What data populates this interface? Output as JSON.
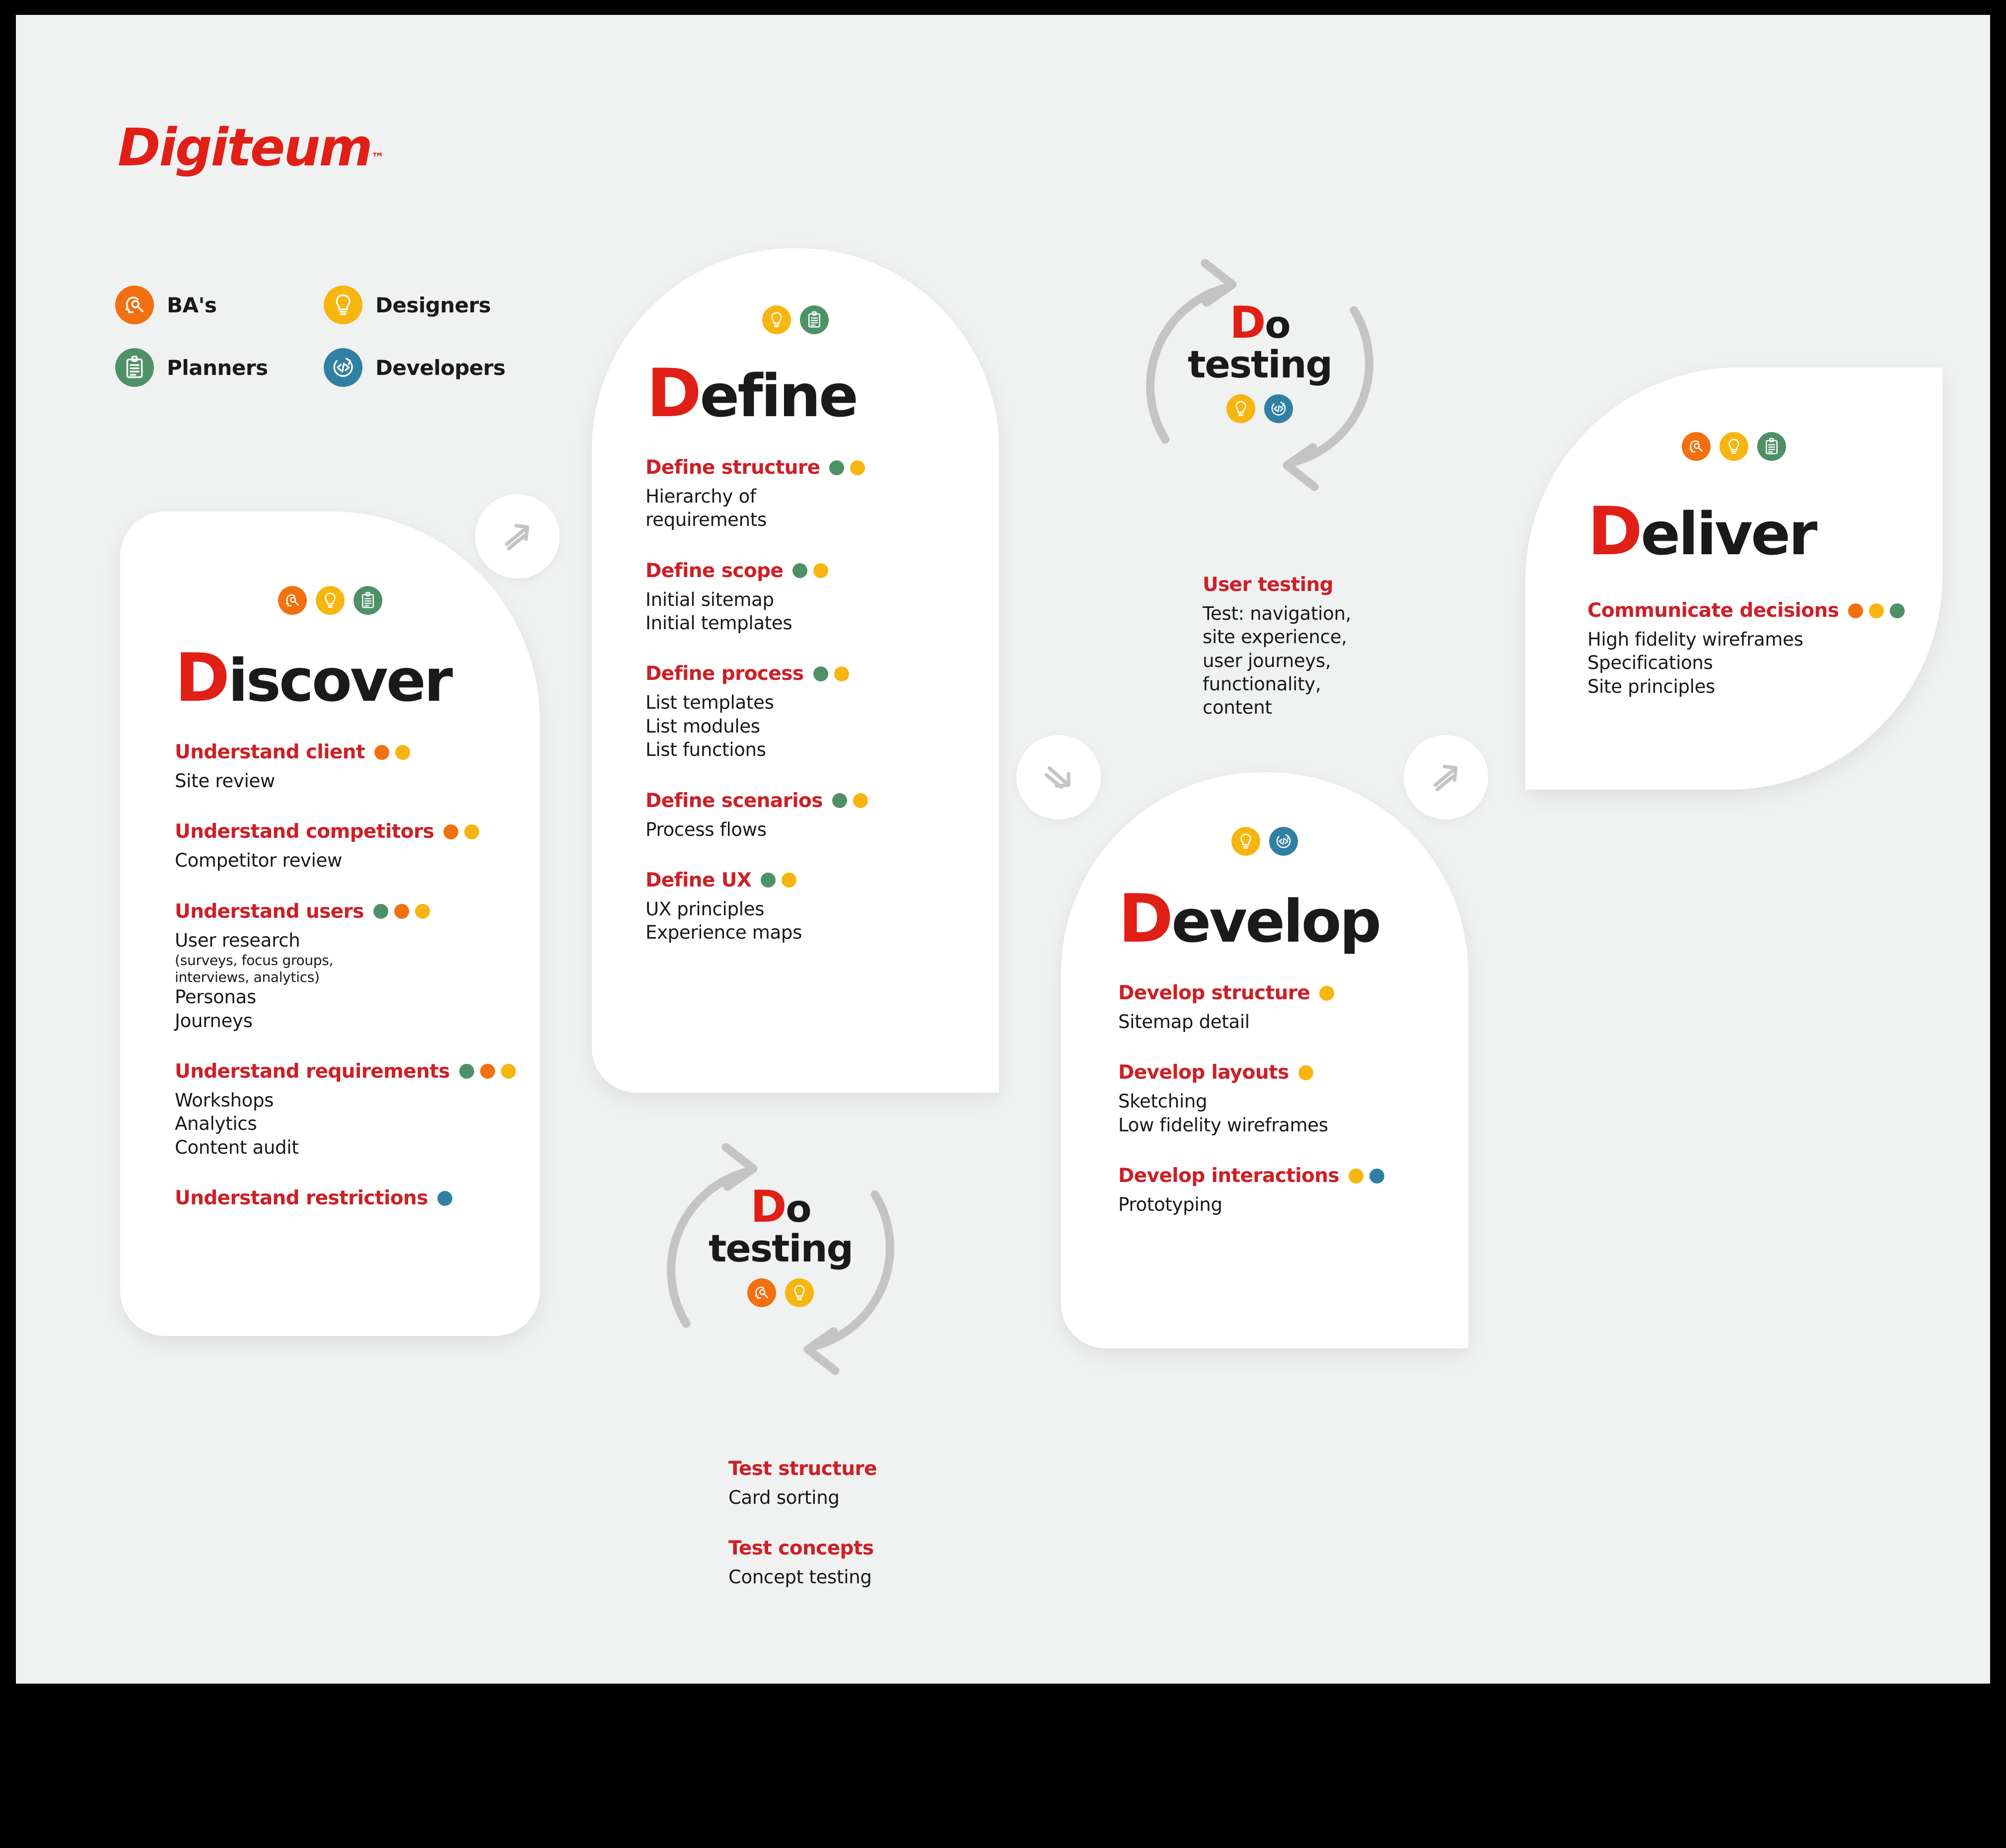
{
  "brand": {
    "name": "Digiteum",
    "tm": "™",
    "color": "#e01f16"
  },
  "palette": {
    "ba": "#f2700f",
    "designers": "#f7b50f",
    "planners": "#4e9166",
    "developers": "#3080a3",
    "heading_red": "#cc2026",
    "title_red": "#e01f16",
    "text_dark": "#18181a",
    "canvas": "#f0f1f1",
    "card": "#ffffff",
    "arrow_gray": "#c4c4c4"
  },
  "legend": {
    "items": [
      {
        "label": "BA's",
        "role": "ba",
        "icon": "head-pencil-icon"
      },
      {
        "label": "Designers",
        "role": "des",
        "icon": "lightbulb-icon"
      },
      {
        "label": "Planners",
        "role": "plan",
        "icon": "clipboard-icon"
      },
      {
        "label": "Developers",
        "role": "dev",
        "icon": "code-icon"
      }
    ]
  },
  "cards": {
    "discover": {
      "cap": "D",
      "rest": "iscover",
      "icons": [
        "ba",
        "des",
        "plan"
      ],
      "sections": [
        {
          "title": "Understand client",
          "dots": [
            "ba",
            "des"
          ],
          "lines": [
            "Site review"
          ]
        },
        {
          "title": "Understand competitors",
          "dots": [
            "ba",
            "des"
          ],
          "lines": [
            "Competitor review"
          ]
        },
        {
          "title": "Understand users",
          "dots": [
            "plan",
            "ba",
            "des"
          ],
          "lines": [
            "User research"
          ],
          "small_lines": [
            "(surveys, focus groups,",
            "interviews, analytics)"
          ],
          "tail_lines": [
            "Personas",
            "Journeys"
          ]
        },
        {
          "title": "Understand requirements",
          "dots": [
            "plan",
            "ba",
            "des"
          ],
          "lines": [
            "Workshops",
            "Analytics",
            "Content audit"
          ]
        },
        {
          "title": "Understand restrictions",
          "dots": [
            "dev"
          ],
          "lines": []
        }
      ]
    },
    "define": {
      "cap": "D",
      "rest": "efine",
      "icons": [
        "des",
        "plan"
      ],
      "sections": [
        {
          "title": "Define structure",
          "dots": [
            "plan",
            "des"
          ],
          "lines": [
            "Hierarchy of",
            "requirements"
          ]
        },
        {
          "title": "Define scope",
          "dots": [
            "plan",
            "des"
          ],
          "lines": [
            "Initial sitemap",
            "Initial templates"
          ]
        },
        {
          "title": "Define process",
          "dots": [
            "plan",
            "des"
          ],
          "lines": [
            "List templates",
            "List modules",
            "List functions"
          ]
        },
        {
          "title": "Define scenarios",
          "dots": [
            "plan",
            "des"
          ],
          "lines": [
            "Process flows"
          ]
        },
        {
          "title": "Define UX",
          "dots": [
            "plan",
            "des"
          ],
          "lines": [
            "UX principles",
            "Experience maps"
          ]
        }
      ]
    },
    "develop": {
      "cap": "D",
      "rest": "evelop",
      "icons": [
        "des",
        "dev"
      ],
      "sections": [
        {
          "title": "Develop structure",
          "dots": [
            "des"
          ],
          "lines": [
            "Sitemap detail"
          ]
        },
        {
          "title": "Develop layouts",
          "dots": [
            "des"
          ],
          "lines": [
            "Sketching",
            "Low fidelity wireframes"
          ]
        },
        {
          "title": "Develop interactions",
          "dots": [
            "des",
            "dev"
          ],
          "lines": [
            "Prototyping"
          ]
        }
      ]
    },
    "deliver": {
      "cap": "D",
      "rest": "eliver",
      "icons": [
        "ba",
        "des",
        "plan"
      ],
      "sections": [
        {
          "title": "Communicate decisions",
          "dots": [
            "ba",
            "des",
            "plan"
          ],
          "lines": [
            "High fidelity wireframes",
            "Specifications",
            "Site principles"
          ]
        }
      ]
    }
  },
  "cycles": {
    "top": {
      "cap": "D",
      "rest": "o",
      "line2": "testing",
      "icons": [
        "des",
        "dev"
      ],
      "sections": [
        {
          "title": "User testing",
          "lines": [
            "Test: navigation,",
            "site experience,",
            "user journeys,",
            "functionality,",
            "content"
          ]
        }
      ]
    },
    "bottom": {
      "cap": "D",
      "rest": "o",
      "line2": "testing",
      "icons": [
        "ba",
        "des"
      ],
      "sections": [
        {
          "title": "Test structure",
          "lines": [
            "Card sorting"
          ]
        },
        {
          "title": "Test concepts",
          "lines": [
            "Concept testing"
          ]
        }
      ]
    }
  },
  "arrows": [
    {
      "name": "arrow-up-right-icon",
      "dir": "up-right"
    },
    {
      "name": "arrow-down-right-icon",
      "dir": "down-right"
    },
    {
      "name": "arrow-up-right-icon",
      "dir": "up-right"
    }
  ]
}
